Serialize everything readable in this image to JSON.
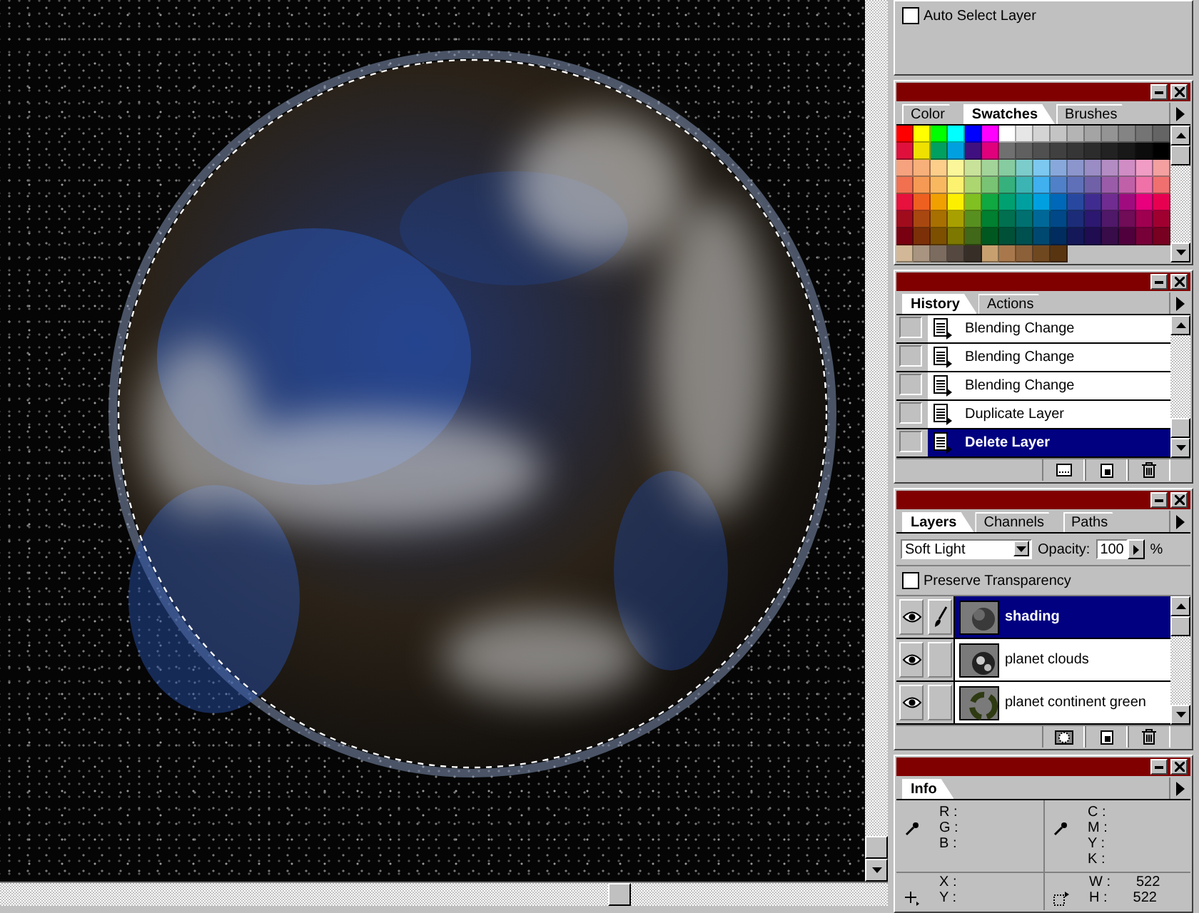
{
  "options_panel": {
    "auto_select_layer": {
      "label": "Auto Select Layer",
      "checked": false
    }
  },
  "swatches_panel": {
    "tabs": [
      {
        "label": "Color",
        "selected": false
      },
      {
        "label": "Swatches",
        "selected": true
      },
      {
        "label": "Brushes",
        "selected": false
      }
    ],
    "swatches": [
      {
        "color": "#ff0000"
      },
      {
        "color": "#ffff00"
      },
      {
        "color": "#00ff00"
      },
      {
        "color": "#00ffff"
      },
      {
        "color": "#0000ff"
      },
      {
        "color": "#ff00ff"
      },
      {
        "color": "#ffffff"
      },
      {
        "color": "#e6e6e6"
      },
      {
        "color": "#d4d4d4"
      },
      {
        "color": "#c4c4c4"
      },
      {
        "color": "#b4b4b4"
      },
      {
        "color": "#a4a4a4"
      },
      {
        "color": "#949494"
      },
      {
        "color": "#848484"
      },
      {
        "color": "#747474"
      },
      {
        "color": "#646464"
      },
      {
        "color": "#e0103c"
      },
      {
        "color": "#f0e000"
      },
      {
        "color": "#00a060"
      },
      {
        "color": "#00a0e0"
      },
      {
        "color": "#401080"
      },
      {
        "color": "#e0007c"
      },
      {
        "color": "#707070"
      },
      {
        "color": "#606060"
      },
      {
        "color": "#505050"
      },
      {
        "color": "#404040"
      },
      {
        "color": "#363636"
      },
      {
        "color": "#2c2c2c"
      },
      {
        "color": "#222222"
      },
      {
        "color": "#181818"
      },
      {
        "color": "#0c0c0c"
      },
      {
        "color": "#000000"
      },
      {
        "color": "#f6a27e"
      },
      {
        "color": "#f8b07a"
      },
      {
        "color": "#fcce8a"
      },
      {
        "color": "#fcf69a"
      },
      {
        "color": "#c8e29a"
      },
      {
        "color": "#a2d49a"
      },
      {
        "color": "#86cca0"
      },
      {
        "color": "#7ccccc"
      },
      {
        "color": "#7cc8f0"
      },
      {
        "color": "#88a8dc"
      },
      {
        "color": "#8c96cc"
      },
      {
        "color": "#9a8cc4"
      },
      {
        "color": "#b48cc4"
      },
      {
        "color": "#d08cc4"
      },
      {
        "color": "#f09cc4"
      },
      {
        "color": "#f4a0a0"
      },
      {
        "color": "#f07050"
      },
      {
        "color": "#f49a54"
      },
      {
        "color": "#f8b860"
      },
      {
        "color": "#fcf270"
      },
      {
        "color": "#acd670"
      },
      {
        "color": "#78c474"
      },
      {
        "color": "#36b07c"
      },
      {
        "color": "#3cb4b4"
      },
      {
        "color": "#40b0ee"
      },
      {
        "color": "#5080c8"
      },
      {
        "color": "#6070b8"
      },
      {
        "color": "#7060a8"
      },
      {
        "color": "#9a5ca8"
      },
      {
        "color": "#c060a8"
      },
      {
        "color": "#f070a8"
      },
      {
        "color": "#f07070"
      },
      {
        "color": "#e8103c"
      },
      {
        "color": "#ee6020"
      },
      {
        "color": "#f0a000"
      },
      {
        "color": "#fcf000"
      },
      {
        "color": "#80c020"
      },
      {
        "color": "#10a840"
      },
      {
        "color": "#00a070"
      },
      {
        "color": "#00a0a0"
      },
      {
        "color": "#00a0e0"
      },
      {
        "color": "#0068b8"
      },
      {
        "color": "#2848a0"
      },
      {
        "color": "#402c90"
      },
      {
        "color": "#702c90"
      },
      {
        "color": "#a00c80"
      },
      {
        "color": "#e8007c"
      },
      {
        "color": "#e80050"
      },
      {
        "color": "#a00c1c"
      },
      {
        "color": "#a84810"
      },
      {
        "color": "#a87000"
      },
      {
        "color": "#a8a000"
      },
      {
        "color": "#589020"
      },
      {
        "color": "#008030"
      },
      {
        "color": "#007050"
      },
      {
        "color": "#007070"
      },
      {
        "color": "#006898"
      },
      {
        "color": "#004888"
      },
      {
        "color": "#1c2c78"
      },
      {
        "color": "#2c1870"
      },
      {
        "color": "#501868"
      },
      {
        "color": "#700c58"
      },
      {
        "color": "#a00050"
      },
      {
        "color": "#a00030"
      },
      {
        "color": "#780010"
      },
      {
        "color": "#7c3008"
      },
      {
        "color": "#7c5000"
      },
      {
        "color": "#7c7800"
      },
      {
        "color": "#406818"
      },
      {
        "color": "#005820"
      },
      {
        "color": "#005038"
      },
      {
        "color": "#005050"
      },
      {
        "color": "#004870"
      },
      {
        "color": "#002c60"
      },
      {
        "color": "#141858"
      },
      {
        "color": "#200c50"
      },
      {
        "color": "#380c48"
      },
      {
        "color": "#50003c"
      },
      {
        "color": "#780038"
      },
      {
        "color": "#780020"
      },
      {
        "color": "#d2b896"
      },
      {
        "color": "#a89480"
      },
      {
        "color": "#7c6c60"
      },
      {
        "color": "#544840"
      },
      {
        "color": "#382e28"
      },
      {
        "color": "#c8a070"
      },
      {
        "color": "#a8784c"
      },
      {
        "color": "#8c6038"
      },
      {
        "color": "#704820"
      },
      {
        "color": "#583410"
      }
    ]
  },
  "history_panel": {
    "tabs": [
      {
        "label": "History",
        "selected": true
      },
      {
        "label": "Actions",
        "selected": false
      }
    ],
    "items": [
      {
        "label": "Blending Change",
        "selected": false
      },
      {
        "label": "Blending Change",
        "selected": false
      },
      {
        "label": "Blending Change",
        "selected": false
      },
      {
        "label": "Duplicate Layer",
        "selected": false
      },
      {
        "label": "Delete Layer",
        "selected": true
      }
    ]
  },
  "layers_panel": {
    "tabs": [
      {
        "label": "Layers",
        "selected": true
      },
      {
        "label": "Channels",
        "selected": false
      },
      {
        "label": "Paths",
        "selected": false
      }
    ],
    "blend_mode": "Soft Light",
    "opacity_label": "Opacity:",
    "opacity": "100",
    "opacity_unit": "%",
    "preserve_transparency": {
      "label": "Preserve Transparency",
      "checked": false
    },
    "layers": [
      {
        "name": "shading",
        "kind": "sphere",
        "visible": true,
        "editing": true,
        "selected": true
      },
      {
        "name": "planet clouds",
        "kind": "clouds",
        "visible": true,
        "editing": false,
        "selected": false
      },
      {
        "name": "planet continent green",
        "kind": "continent",
        "visible": true,
        "editing": false,
        "selected": false
      }
    ]
  },
  "info_panel": {
    "tabs": [
      {
        "label": "Info",
        "selected": true
      }
    ],
    "rgb_labels": [
      "R :",
      "G :",
      "B :"
    ],
    "cmyk_labels": [
      "C :",
      "M :",
      "Y :",
      "K :"
    ],
    "xy_labels": [
      "X :",
      "Y :"
    ],
    "size": [
      {
        "label": "W :",
        "value": "522"
      },
      {
        "label": "H :",
        "value": "522"
      }
    ]
  }
}
